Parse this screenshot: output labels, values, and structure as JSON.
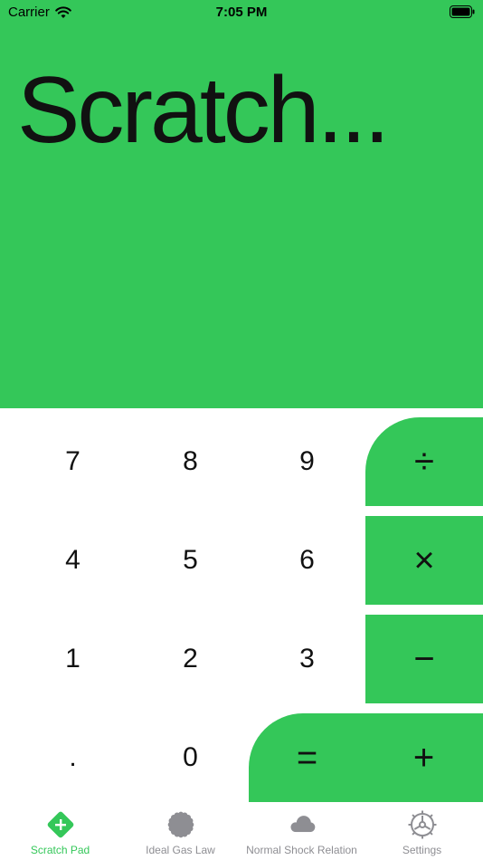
{
  "status_bar": {
    "carrier": "Carrier",
    "time": "7:05 PM"
  },
  "display": {
    "text": "Scratch..."
  },
  "keypad": {
    "numbers": [
      "7",
      "8",
      "9",
      "4",
      "5",
      "6",
      "1",
      "2",
      "3",
      ".",
      "0"
    ],
    "operators": {
      "divide": "÷",
      "multiply": "×",
      "subtract": "−",
      "equals": "=",
      "add": "+"
    }
  },
  "tabs": [
    {
      "label": "Scratch Pad",
      "icon": "plus-diamond-icon",
      "active": true
    },
    {
      "label": "Ideal Gas Law",
      "icon": "badge-icon",
      "active": false
    },
    {
      "label": "Normal Shock Relation",
      "icon": "cloud-icon",
      "active": false
    },
    {
      "label": "Settings",
      "icon": "gear-icon",
      "active": false
    }
  ],
  "colors": {
    "accent": "#34c759",
    "inactive": "#8e8e93"
  }
}
